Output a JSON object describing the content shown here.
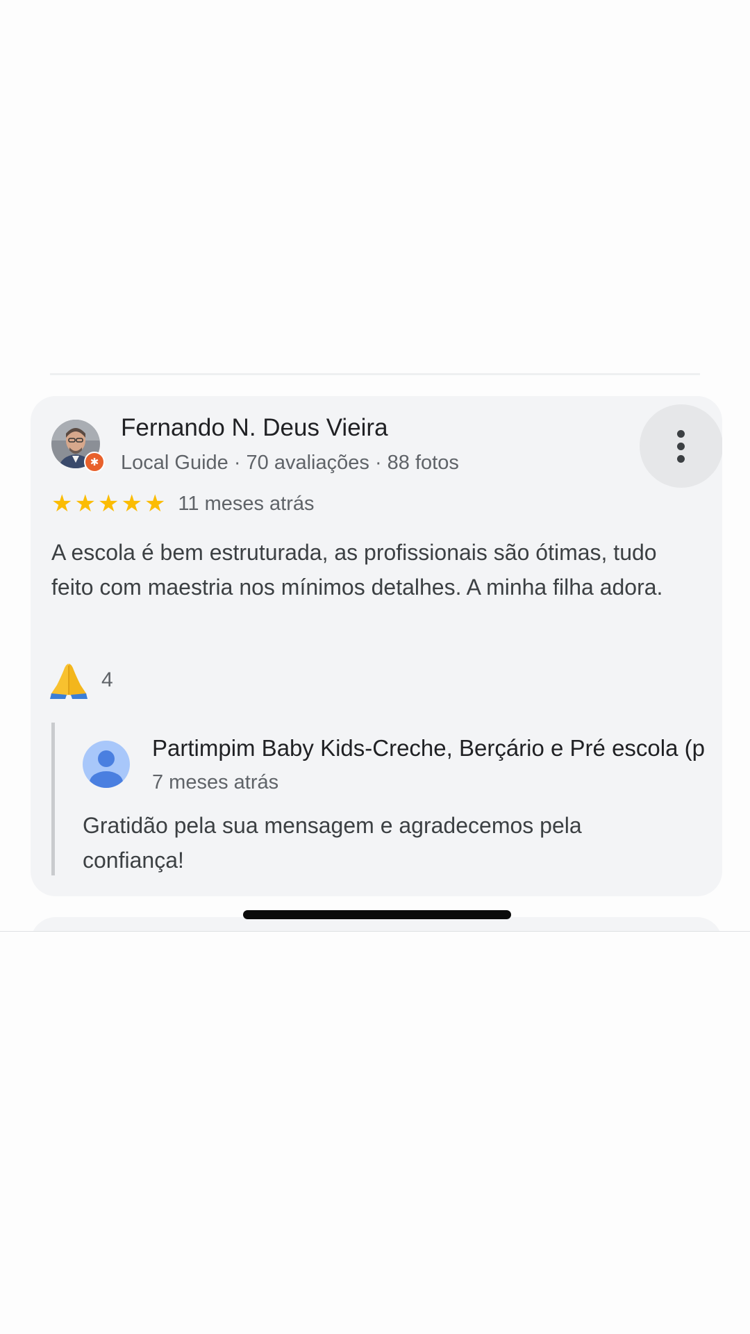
{
  "review": {
    "reviewer_name": "Fernando N. Deus Vieira",
    "reviewer_meta": "Local Guide · 70 avaliações · 88 fotos",
    "rating": 5,
    "stars": [
      "★",
      "★",
      "★",
      "★",
      "★"
    ],
    "date": "11 meses atrás",
    "text": "A escola é bem estruturada, as profissionais são ótimas, tudo feito com maestria nos mínimos detalhes. A minha filha adora.",
    "reaction_emoji": "🙏",
    "reaction_count": "4",
    "menu_icon": "more-vert-icon"
  },
  "owner_reply": {
    "name": "Partimpim Baby Kids-Creche, Berçário e Pré escola (p",
    "date": "7 meses atrás",
    "text": "Gratidão pela sua mensagem e agradecemos pela confiança!"
  },
  "colors": {
    "card_background": "#f3f4f6",
    "star": "#fbbc04",
    "local_guide_badge": "#e8612c",
    "owner_avatar": "#7baaf7"
  }
}
